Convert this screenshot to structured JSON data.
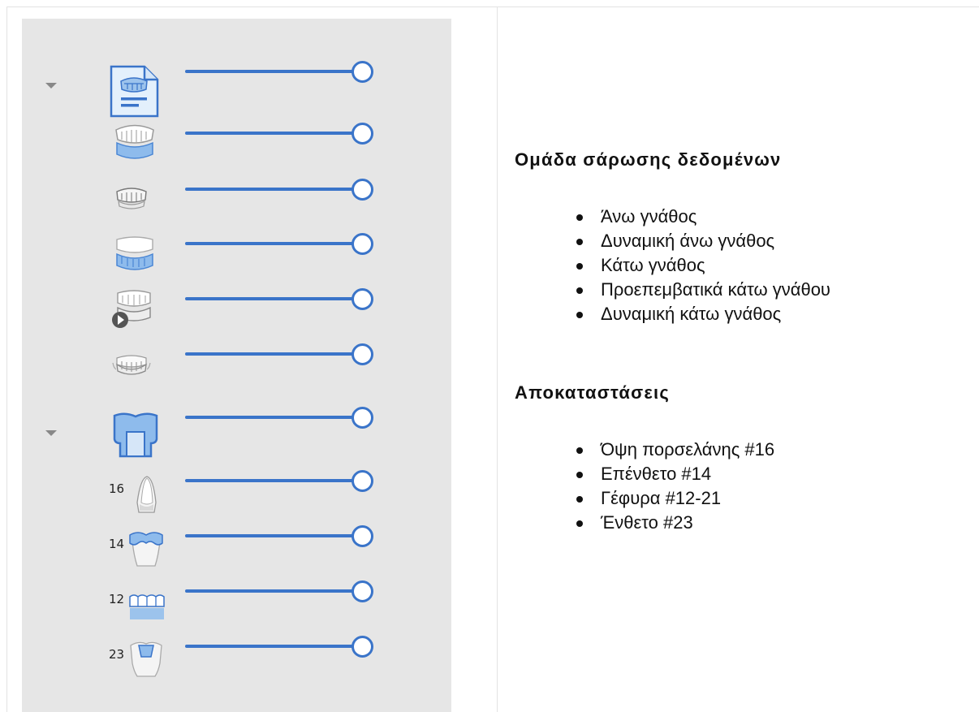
{
  "colors": {
    "panel_bg": "#e6e6e6",
    "slider_accent": "#3a74c9",
    "heading_text": "#111111"
  },
  "layers": {
    "groups": [
      {
        "name": "scan-data",
        "expanded": true,
        "icon": "document-jaw-icon",
        "opacity": 1.0,
        "items": [
          {
            "icon": "upper-jaw-icon",
            "label": "",
            "opacity": 1.0
          },
          {
            "icon": "upper-jaw-small-icon",
            "label": "",
            "opacity": 1.0
          },
          {
            "icon": "lower-jaw-icon",
            "label": "",
            "opacity": 1.0
          },
          {
            "icon": "lower-jaw-play-icon",
            "label": "",
            "opacity": 1.0
          },
          {
            "icon": "lower-jaw-small-icon",
            "label": "",
            "opacity": 1.0
          }
        ]
      },
      {
        "name": "restorations",
        "expanded": true,
        "icon": "crown-icon",
        "opacity": 1.0,
        "items": [
          {
            "icon": "veneer-icon",
            "label": "16",
            "opacity": 1.0
          },
          {
            "icon": "onlay-icon",
            "label": "14",
            "opacity": 1.0
          },
          {
            "icon": "bridge-icon",
            "label": "12",
            "opacity": 1.0
          },
          {
            "icon": "inlay-icon",
            "label": "23",
            "opacity": 1.0
          }
        ]
      }
    ]
  },
  "sections": [
    {
      "heading": "Ομάδα σάρωσης δεδομένων",
      "items": [
        "Άνω γνάθος",
        "Δυναμική άνω γνάθος",
        "Κάτω γνάθος",
        "Προεπεμβατικά κάτω γνάθου",
        "Δυναμική κάτω γνάθος"
      ]
    },
    {
      "heading": "Αποκαταστάσεις",
      "items": [
        "Όψη πορσελάνης #16",
        "Επένθετο #14",
        "Γέφυρα #12-21",
        "Ένθετο #23"
      ]
    }
  ]
}
